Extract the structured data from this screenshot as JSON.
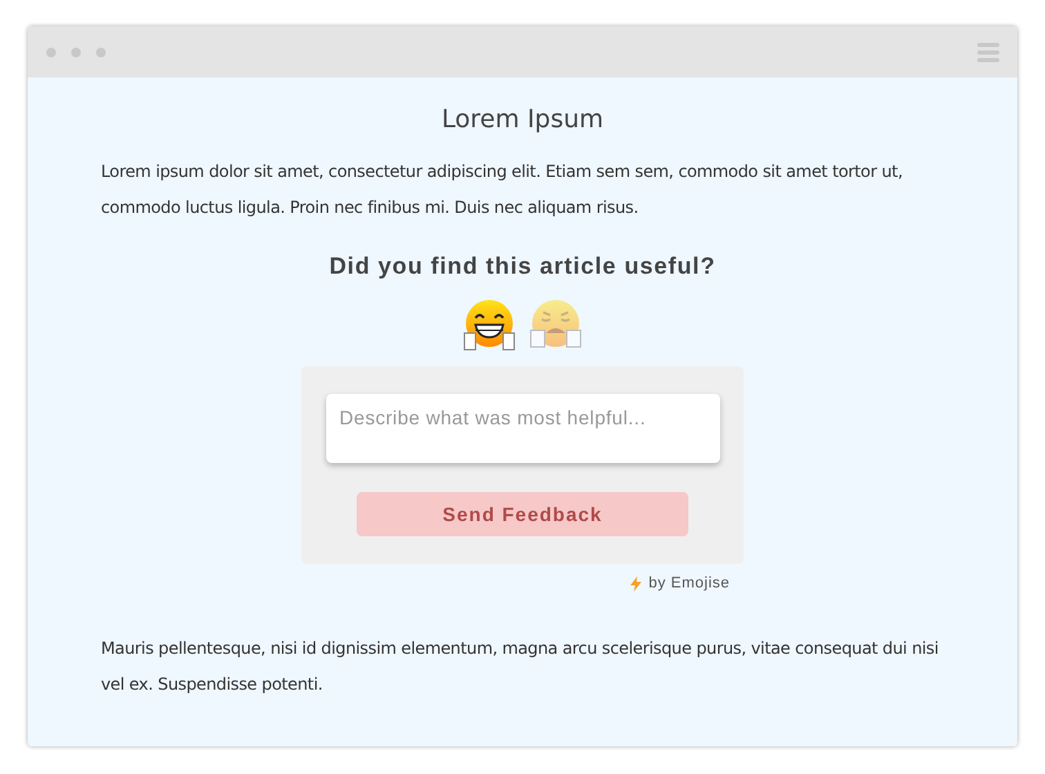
{
  "article": {
    "title": "Lorem Ipsum",
    "intro": "Lorem ipsum dolor sit amet, consectetur adipiscing elit. Etiam sem sem, commodo sit amet tortor ut, commodo luctus ligula. Proin nec finibus mi. Duis nec aliquam risus.",
    "outro": "Mauris pellentesque, nisi id dignissim elementum, magna arcu scelerisque purus, vitae consequat dui nisi vel ex. Suspendisse potenti."
  },
  "feedback": {
    "question": "Did you find this article useful?",
    "reactions": [
      {
        "kind": "happy",
        "selected": true
      },
      {
        "kind": "unhappy",
        "selected": false
      }
    ],
    "field": {
      "placeholder": "Describe what was most helpful..."
    },
    "button": {
      "label": "Send Feedback",
      "disabled": true
    },
    "credit": "by Emojise"
  }
}
